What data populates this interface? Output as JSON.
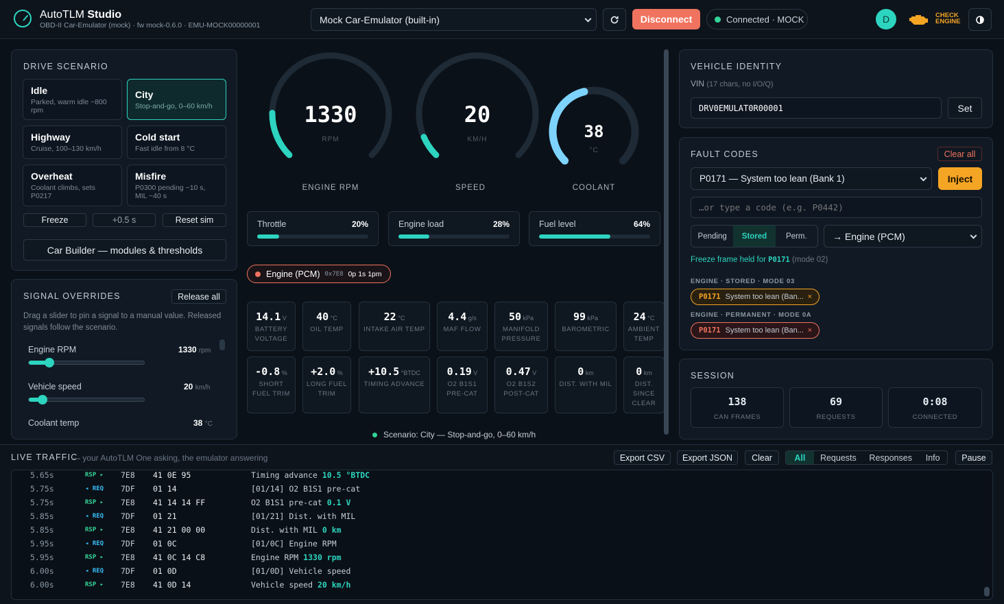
{
  "header": {
    "title_a": "AutoTLM ",
    "title_b": "Studio",
    "subtitle": "OBD-II Car-Emulator (mock) · fw mock-0.6.0 · EMU-MOCK00000001",
    "device_select": "Mock Car-Emulator (built-in)",
    "disconnect_label": "Disconnect",
    "status": "Connected · MOCK",
    "avatar_letter": "D",
    "cel_line1": "CHECK",
    "cel_line2": "ENGINE",
    "cel_color": "#f5a524"
  },
  "scenario": {
    "title": "DRIVE SCENARIO",
    "items": [
      {
        "name": "Idle",
        "desc": "Parked, warm idle ~800 rpm"
      },
      {
        "name": "City",
        "desc": "Stop-and-go, 0–60 km/h",
        "active": true
      },
      {
        "name": "Highway",
        "desc": "Cruise, 100–130 km/h"
      },
      {
        "name": "Cold start",
        "desc": "Fast idle from 8 °C"
      },
      {
        "name": "Overheat",
        "desc": "Coolant climbs, sets P0217"
      },
      {
        "name": "Misfire",
        "desc": "P0300 pending ~10 s, MIL ~40 s"
      }
    ],
    "freeze": "Freeze",
    "step": "+0.5 s",
    "reset": "Reset sim",
    "builder": "Car Builder — modules & thresholds"
  },
  "overrides": {
    "title": "SIGNAL OVERRIDES",
    "release_all": "Release all",
    "help": "Drag a slider to pin a signal to a manual value. Released signals follow the scenario.",
    "items": [
      {
        "label": "Engine RPM",
        "value": "1330",
        "unit": "rpm",
        "level": 0.18
      },
      {
        "label": "Vehicle speed",
        "value": "20",
        "unit": "km/h",
        "level": 0.12
      },
      {
        "label": "Coolant temp",
        "value": "38",
        "unit": "°C"
      }
    ]
  },
  "gauges": [
    {
      "value": "1330",
      "unit": "RPM",
      "label": "ENGINE RPM",
      "fraction": 0.17
    },
    {
      "value": "20",
      "unit": "KM/H",
      "label": "SPEED",
      "fraction": 0.08
    },
    {
      "value": "38",
      "unit": "°C",
      "label": "COOLANT",
      "fraction": 0.45
    }
  ],
  "bars": [
    {
      "label": "Throttle",
      "value": "20%",
      "level": 0.2
    },
    {
      "label": "Engine load",
      "value": "28%",
      "level": 0.28
    },
    {
      "label": "Fuel level",
      "value": "64%",
      "level": 0.64
    }
  ],
  "module": {
    "name": "Engine (PCM)",
    "addr": "0x7E8",
    "stats": "0p 1s 1pm"
  },
  "tiles_row1": [
    {
      "value": "14.1",
      "unit": "V",
      "name": "BATTERY VOLTAGE"
    },
    {
      "value": "40",
      "unit": "°C",
      "name": "OIL TEMP"
    },
    {
      "value": "22",
      "unit": "°C",
      "name": "INTAKE AIR TEMP"
    },
    {
      "value": "4.4",
      "unit": "g/s",
      "name": "MAF FLOW"
    },
    {
      "value": "50",
      "unit": "kPa",
      "name": "MANIFOLD PRESSURE"
    },
    {
      "value": "99",
      "unit": "kPa",
      "name": "BAROMETRIC"
    },
    {
      "value": "24",
      "unit": "°C",
      "name": "AMBIENT TEMP"
    }
  ],
  "tiles_row2": [
    {
      "value": "-0.8",
      "unit": "%",
      "name": "SHORT FUEL TRIM"
    },
    {
      "value": "+2.0",
      "unit": "%",
      "name": "LONG FUEL TRIM"
    },
    {
      "value": "+10.5",
      "unit": "°BTDC",
      "name": "TIMING ADVANCE"
    },
    {
      "value": "0.19",
      "unit": "V",
      "name": "O2 B1S1 PRE-CAT"
    },
    {
      "value": "0.47",
      "unit": "V",
      "name": "O2 B1S2 POST-CAT"
    },
    {
      "value": "0",
      "unit": "km",
      "name": "DIST. WITH MIL"
    },
    {
      "value": "0",
      "unit": "km",
      "name": "DIST. SINCE CLEAR"
    }
  ],
  "scenario_status": "Scenario: City — Stop-and-go, 0–60 km/h",
  "identity": {
    "title": "VEHICLE IDENTITY",
    "vin_label": "VIN",
    "vin_hint": "(17 chars, no I/O/Q)",
    "vin_value": "DRV0EMULAT0R00001",
    "set": "Set"
  },
  "faults": {
    "title": "FAULT CODES",
    "clear_all": "Clear all",
    "code_select": "P0171 — System too lean (Bank 1)",
    "inject": "Inject",
    "placeholder": "…or type a code (e.g. P0442)",
    "seg": [
      "Pending",
      "Stored",
      "Perm."
    ],
    "target": "→ Engine (PCM)",
    "freeze_a": "Freeze frame held for ",
    "freeze_code": "P0171",
    "freeze_b": " (mode 02)",
    "group1": "ENGINE · STORED · MODE 03",
    "group2": "ENGINE · PERMANENT · MODE 0A",
    "dtc_code": "P0171",
    "dtc_desc": "System too lean (Ban...",
    "close": "×",
    "stored_color": "#f5a524",
    "perm_color": "#f0735f"
  },
  "session": {
    "title": "SESSION",
    "stats": [
      {
        "value": "138",
        "label": "CAN FRAMES"
      },
      {
        "value": "69",
        "label": "REQUESTS"
      },
      {
        "value": "0:08",
        "label": "CONNECTED"
      }
    ]
  },
  "traffic": {
    "title": "LIVE TRAFFIC",
    "sub": "— your AutoTLM One asking, the emulator answering",
    "export_csv": "Export CSV",
    "export_json": "Export JSON",
    "clear": "Clear",
    "filters": [
      "All",
      "Requests",
      "Responses",
      "Info"
    ],
    "pause": "Pause",
    "rows": [
      {
        "ts": "5.65s",
        "dir": "RSP ▸",
        "id": "7E8",
        "hex": "41 0E 95",
        "desc": "Timing advance ",
        "hl": "10.5 °BTDC"
      },
      {
        "ts": "5.75s",
        "dir": "◂ REQ",
        "id": "7DF",
        "hex": "01 14",
        "desc": "[01/14] O2 B1S1 pre-cat",
        "hl": ""
      },
      {
        "ts": "5.75s",
        "dir": "RSP ▸",
        "id": "7E8",
        "hex": "41 14 14 FF",
        "desc": "O2 B1S1 pre-cat ",
        "hl": "0.1 V"
      },
      {
        "ts": "5.85s",
        "dir": "◂ REQ",
        "id": "7DF",
        "hex": "01 21",
        "desc": "[01/21] Dist. with MIL",
        "hl": ""
      },
      {
        "ts": "5.85s",
        "dir": "RSP ▸",
        "id": "7E8",
        "hex": "41 21 00 00",
        "desc": "Dist. with MIL ",
        "hl": "0 km"
      },
      {
        "ts": "5.95s",
        "dir": "◂ REQ",
        "id": "7DF",
        "hex": "01 0C",
        "desc": "[01/0C] Engine RPM",
        "hl": ""
      },
      {
        "ts": "5.95s",
        "dir": "RSP ▸",
        "id": "7E8",
        "hex": "41 0C 14 C8",
        "desc": "Engine RPM ",
        "hl": "1330 rpm"
      },
      {
        "ts": "6.00s",
        "dir": "◂ REQ",
        "id": "7DF",
        "hex": "01 0D",
        "desc": "[01/0D] Vehicle speed",
        "hl": ""
      },
      {
        "ts": "6.00s",
        "dir": "RSP ▸",
        "id": "7E8",
        "hex": "41 0D 14",
        "desc": "Vehicle speed ",
        "hl": "20 km/h"
      }
    ]
  },
  "colors": {
    "accent": "#2dd4bf",
    "req": "#38bdf8",
    "rsp": "#34d399",
    "coolant": "#7dd3fc"
  }
}
